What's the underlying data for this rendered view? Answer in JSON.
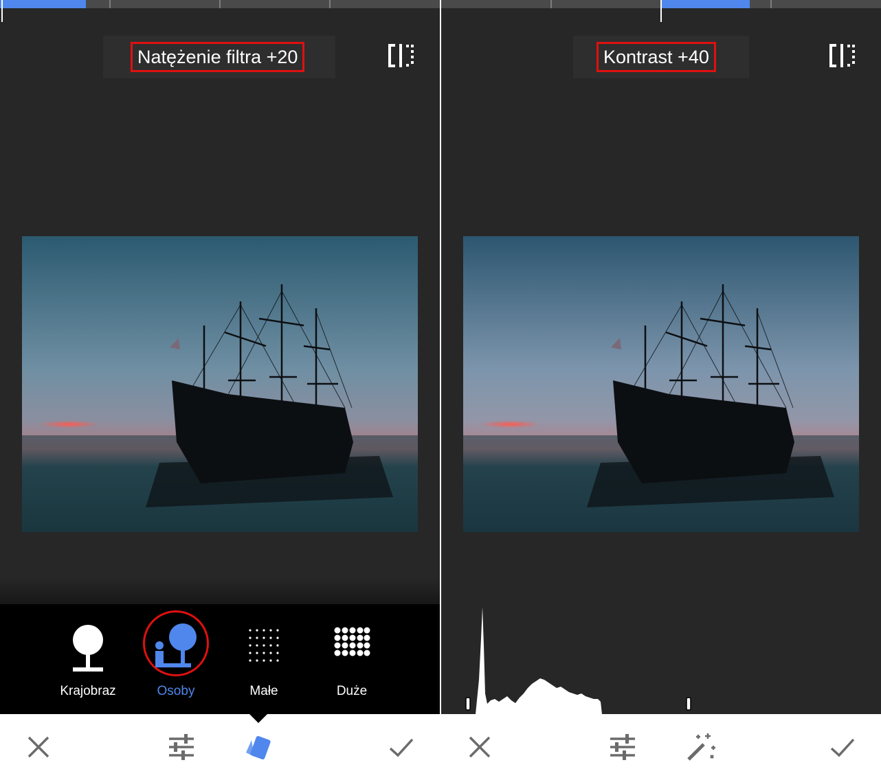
{
  "left_panel": {
    "value_label": "Natężenie filtra +20",
    "styles": [
      {
        "label": "Krajobraz",
        "icon": "landscape-icon",
        "selected": false
      },
      {
        "label": "Osoby",
        "icon": "portrait-people-icon",
        "selected": true
      },
      {
        "label": "Małe",
        "icon": "small-dots-icon",
        "selected": false
      },
      {
        "label": "Duże",
        "icon": "large-dots-icon",
        "selected": false
      }
    ],
    "toolbar": [
      "close-icon",
      "adjust-sliders-icon",
      "styles-icon",
      "checkmark-icon"
    ]
  },
  "right_panel": {
    "value_label": "Kontrast +40",
    "toolbar": [
      "close-icon",
      "adjust-sliders-icon",
      "auto-magic-wand-icon",
      "checkmark-icon"
    ]
  },
  "colors": {
    "accent": "#4f87ec",
    "highlight": "#e01010",
    "panel_bg": "#272727",
    "strip_bg": "#000000"
  }
}
